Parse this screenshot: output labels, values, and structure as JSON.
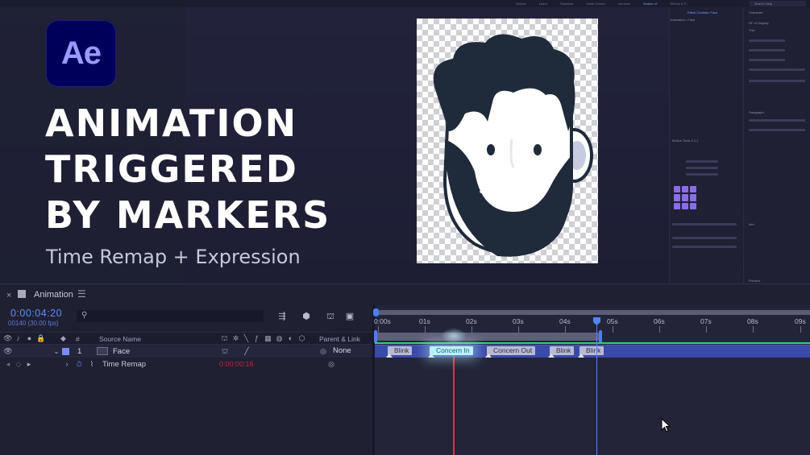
{
  "app": {
    "logo_text": "Ae",
    "workspace_tabs": [
      "Default",
      "Learn",
      "Standard",
      "Small Screen",
      "Libraries",
      "Motion v2",
      "Effects & P..."
    ],
    "search_placeholder": "Search Help",
    "panels": {
      "effect_controls": "Effect Controls: Face",
      "effect_controls_sub": "Animation • Face",
      "character": "Character",
      "font_name": "SF UI Display",
      "font_style": "Thin",
      "paragraph": "Paragraph",
      "motion_tools": "Motion Tools 2.1.1",
      "info": "Info",
      "preview": "Preview"
    }
  },
  "overlay": {
    "title_lines": [
      "ANIMATION",
      "TRIGGERED",
      "BY MARKERS"
    ],
    "subtitle": "Time Remap + Expression"
  },
  "timeline": {
    "comp_name": "Animation",
    "current_time": "0:00:04:20",
    "frames_info": "00140 (30.00 fps)",
    "search_placeholder": "",
    "columns": {
      "number": "#",
      "source_name": "Source Name",
      "parent_link": "Parent & Link"
    },
    "layer": {
      "index": "1",
      "name": "Face",
      "parent": "None",
      "label_color": "#7a8cff"
    },
    "property": {
      "name": "Time Remap",
      "value": "0:00:00:16"
    },
    "ruler_labels": [
      "0:00s",
      "01s",
      "02s",
      "03s",
      "04s",
      "05s",
      "06s",
      "07s",
      "08s",
      "09s"
    ],
    "markers": [
      "Blink",
      "Concern In",
      "Concern Out",
      "Blink",
      "Blink"
    ],
    "active_marker": "Concern In",
    "colors": {
      "accent": "#4d86ff",
      "green_bar": "#33d36b",
      "layer_bar": "#3a4aa8",
      "red_line": "#e0304a",
      "label_purple": "#8b6cf0"
    }
  }
}
